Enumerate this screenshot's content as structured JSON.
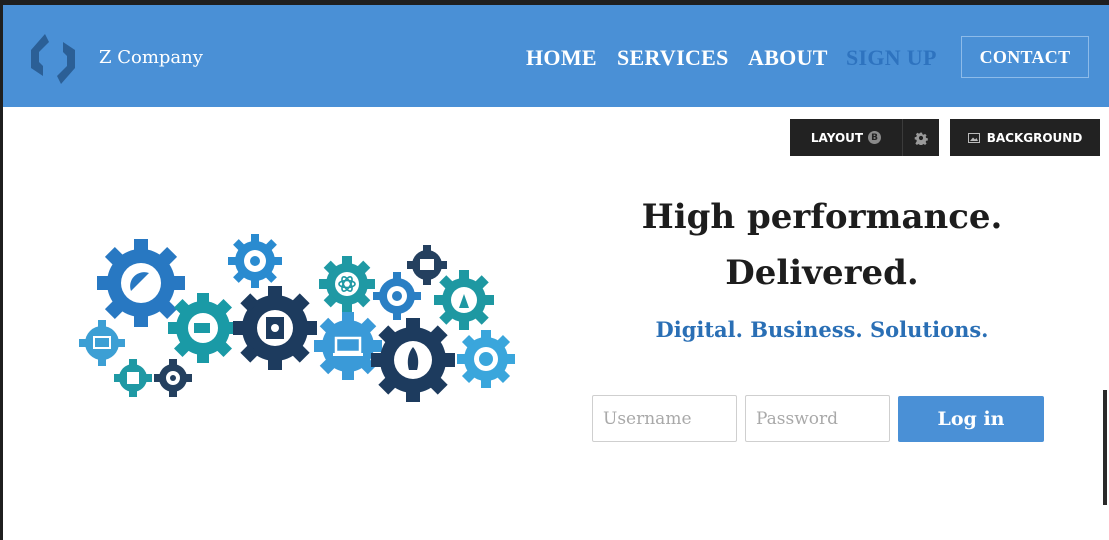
{
  "brand": {
    "name": "Z Company",
    "colors": {
      "header": "#4a90d6",
      "signup": "#2e73bf",
      "tagline": "#2a6fb5",
      "toolbar": "#222222"
    }
  },
  "nav": {
    "items": [
      {
        "label": "HOME",
        "icon": null
      },
      {
        "label": "SERVICES",
        "icon": null
      },
      {
        "label": "ABOUT",
        "icon": null
      },
      {
        "label": "SIGN UP",
        "icon": null
      }
    ],
    "contact_label": "CONTACT"
  },
  "toolbar": {
    "layout_label": "LAYOUT",
    "layout_badge": "B",
    "settings_icon": "gear-icon",
    "background_label": "BACKGROUND",
    "background_icon": "image-icon"
  },
  "hero": {
    "headline_line1": "High performance.",
    "headline_line2": "Delivered.",
    "tagline": "Digital. Business. Solutions.",
    "illustration_icons": [
      "satellite-dish-icon",
      "monitor-icon",
      "battery-icon",
      "chip-icon",
      "hard-drive-icon",
      "atom-icon",
      "webcam-icon",
      "laptop-icon",
      "rocket-icon",
      "terminal-icon",
      "antenna-icon",
      "dial-icon",
      "brain-icon",
      "target-icon"
    ]
  },
  "login": {
    "username_placeholder": "Username",
    "password_placeholder": "Password",
    "submit_label": "Log in"
  }
}
